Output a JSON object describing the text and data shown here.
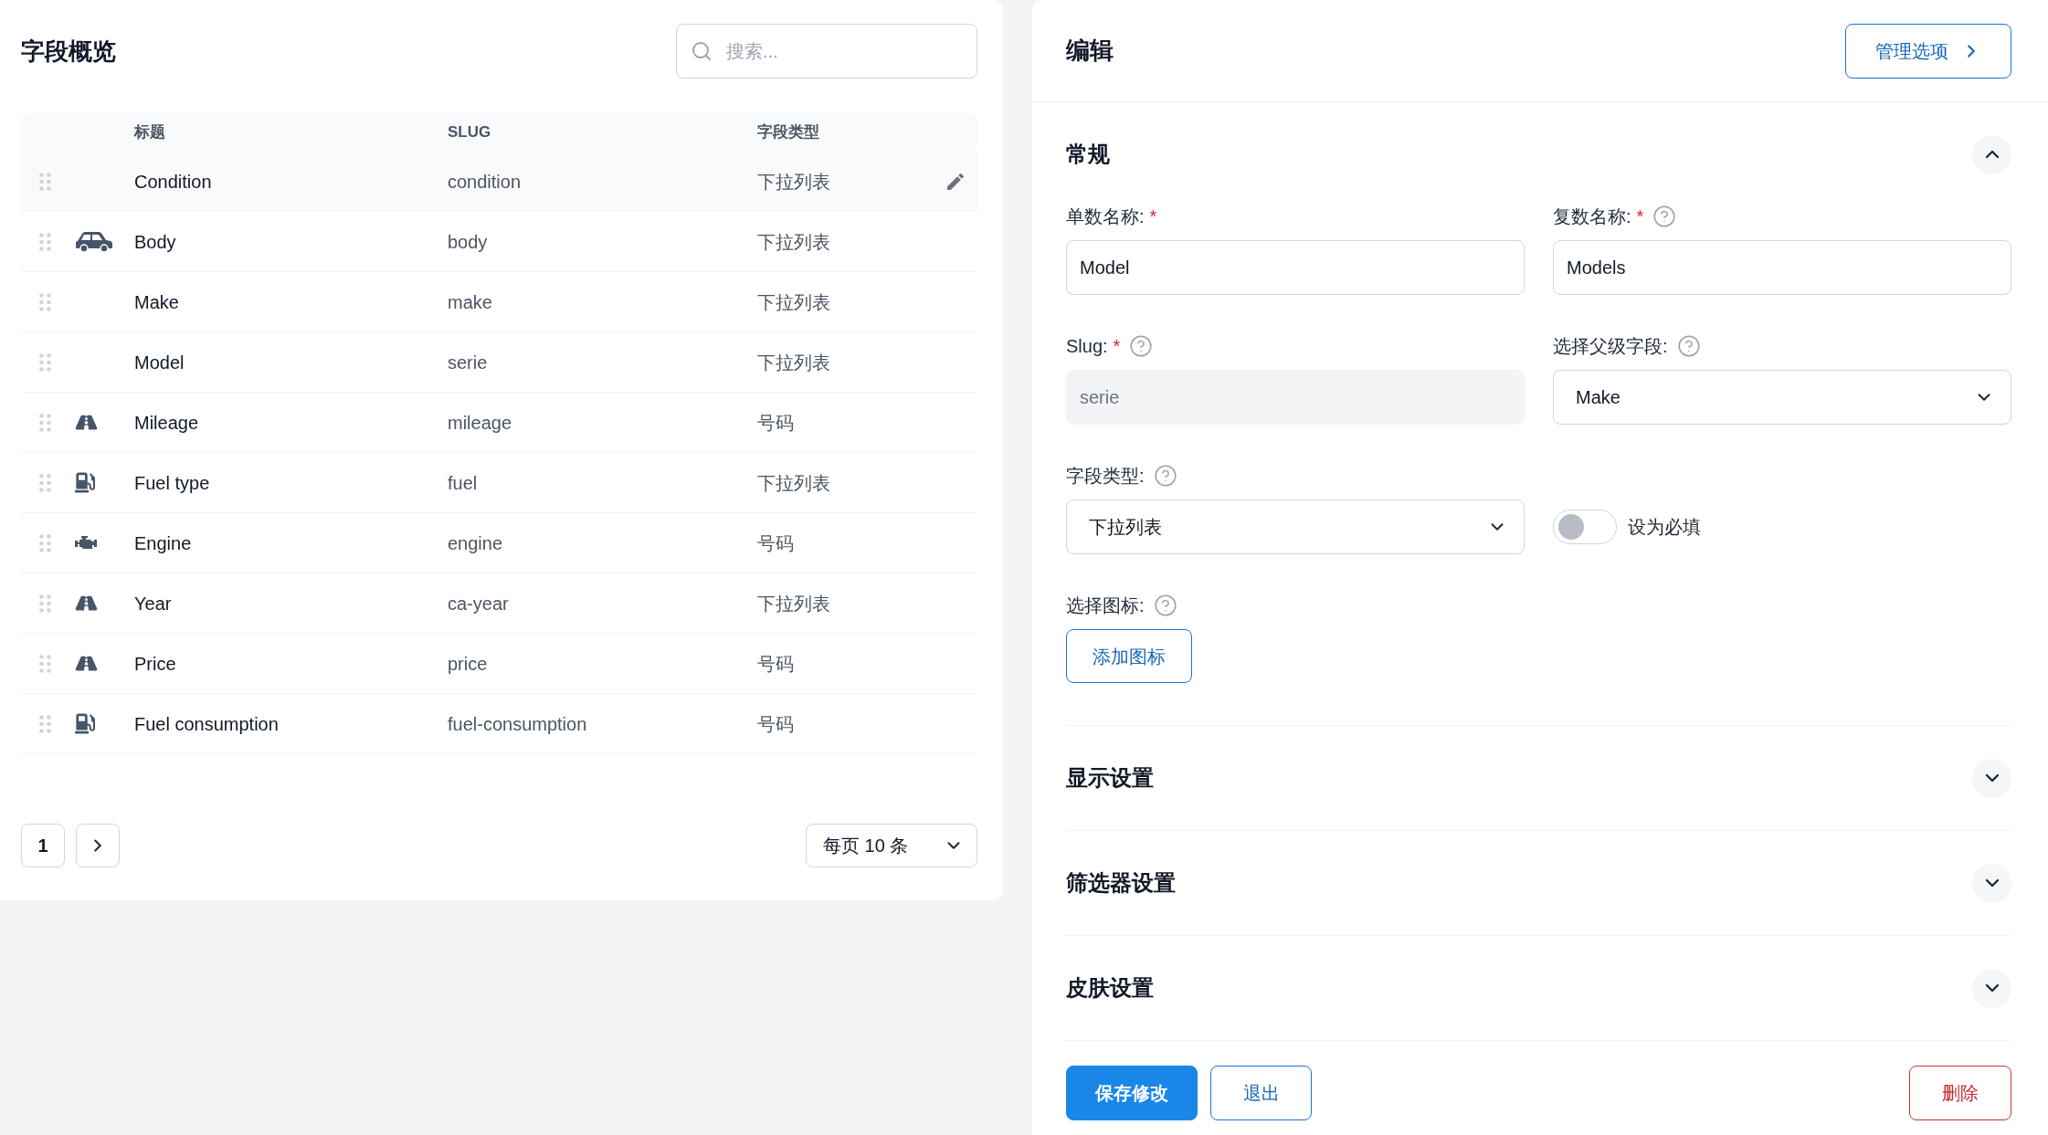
{
  "overview": {
    "title": "字段概览",
    "search": {
      "placeholder": "搜索..."
    },
    "table": {
      "columns": [
        "标题",
        "SLUG",
        "字段类型"
      ],
      "rows": [
        {
          "kind": "none",
          "title": "Condition",
          "slug": "condition",
          "type": "下拉列表",
          "highlighted": true
        },
        {
          "kind": "car",
          "title": "Body",
          "slug": "body",
          "type": "下拉列表",
          "highlighted": false
        },
        {
          "kind": "none",
          "title": "Make",
          "slug": "make",
          "type": "下拉列表",
          "highlighted": false
        },
        {
          "kind": "none",
          "title": "Model",
          "slug": "serie",
          "type": "下拉列表",
          "highlighted": false
        },
        {
          "kind": "road",
          "title": "Mileage",
          "slug": "mileage",
          "type": "号码",
          "highlighted": false
        },
        {
          "kind": "fuel",
          "title": "Fuel type",
          "slug": "fuel",
          "type": "下拉列表",
          "highlighted": false
        },
        {
          "kind": "engine",
          "title": "Engine",
          "slug": "engine",
          "type": "号码",
          "highlighted": false
        },
        {
          "kind": "road",
          "title": "Year",
          "slug": "ca-year",
          "type": "下拉列表",
          "highlighted": false
        },
        {
          "kind": "road",
          "title": "Price",
          "slug": "price",
          "type": "号码",
          "highlighted": false
        },
        {
          "kind": "fuel",
          "title": "Fuel consumption",
          "slug": "fuel-consumption",
          "type": "号码",
          "highlighted": false
        }
      ]
    },
    "pagination": {
      "pages": [
        {
          "label": "1",
          "selected": true
        }
      ],
      "per_page": "每页 10 条"
    }
  },
  "editor": {
    "title": "编辑",
    "manage_button": "管理选项",
    "sections": [
      {
        "title": "常规",
        "expanded": true,
        "fields": [
          {
            "kind": "text",
            "label": "单数名称:",
            "required_mark": "*",
            "help": false,
            "value": "Model",
            "disabled": false
          },
          {
            "kind": "text",
            "label": "复数名称:",
            "required_mark": "*",
            "help": true,
            "value": "Models",
            "disabled": false
          },
          {
            "kind": "text",
            "label": "Slug:",
            "required_mark": "*",
            "help": true,
            "value": "serie",
            "disabled": true
          },
          {
            "kind": "select",
            "label": "选择父级字段:",
            "help": true,
            "value": "Make"
          },
          {
            "kind": "select",
            "label": "字段类型:",
            "help": true,
            "value": "下拉列表"
          },
          {
            "kind": "toggle",
            "label": "设为必填",
            "on": false
          },
          {
            "kind": "icon_picker",
            "label": "选择图标:",
            "help": true,
            "button": "添加图标"
          }
        ]
      },
      {
        "title": "显示设置",
        "expanded": false
      },
      {
        "title": "筛选器设置",
        "expanded": false
      },
      {
        "title": "皮肤设置",
        "expanded": false
      }
    ],
    "buttons": [
      {
        "label": "保存修改",
        "kind": "primary"
      },
      {
        "label": "退出",
        "kind": "secondary"
      },
      {
        "label": "删除",
        "kind": "danger"
      }
    ]
  }
}
